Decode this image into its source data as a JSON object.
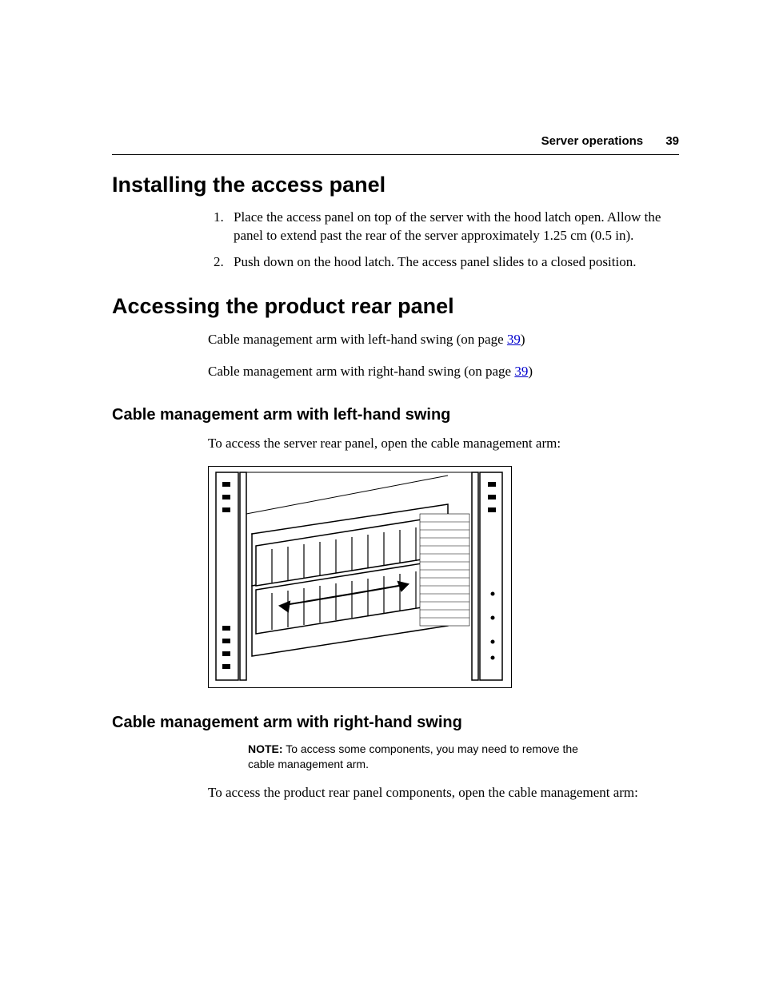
{
  "header": {
    "section": "Server operations",
    "page_number": "39"
  },
  "h1_install": "Installing the access panel",
  "steps": {
    "s1": "Place the access panel on top of the server with the hood latch open. Allow the panel to extend past the rear of the server approximately 1.25 cm (0.5 in).",
    "s2": "Push down on the hood latch. The access panel slides to a closed position."
  },
  "h1_access": "Accessing the product rear panel",
  "links": {
    "left_prefix": "Cable management arm with left-hand swing (on page ",
    "left_page": "39",
    "left_suffix": ")",
    "right_prefix": "Cable management arm with right-hand swing (on page ",
    "right_page": "39",
    "right_suffix": ")"
  },
  "h2_left": "Cable management arm with left-hand swing",
  "left_body": "To access the server rear panel, open the cable management arm:",
  "h2_right": "Cable management arm with right-hand swing",
  "note": {
    "label": "NOTE:",
    "text": "  To access some components, you may need to remove the cable management arm."
  },
  "right_body": "To access the product rear panel components, open the cable management arm:"
}
